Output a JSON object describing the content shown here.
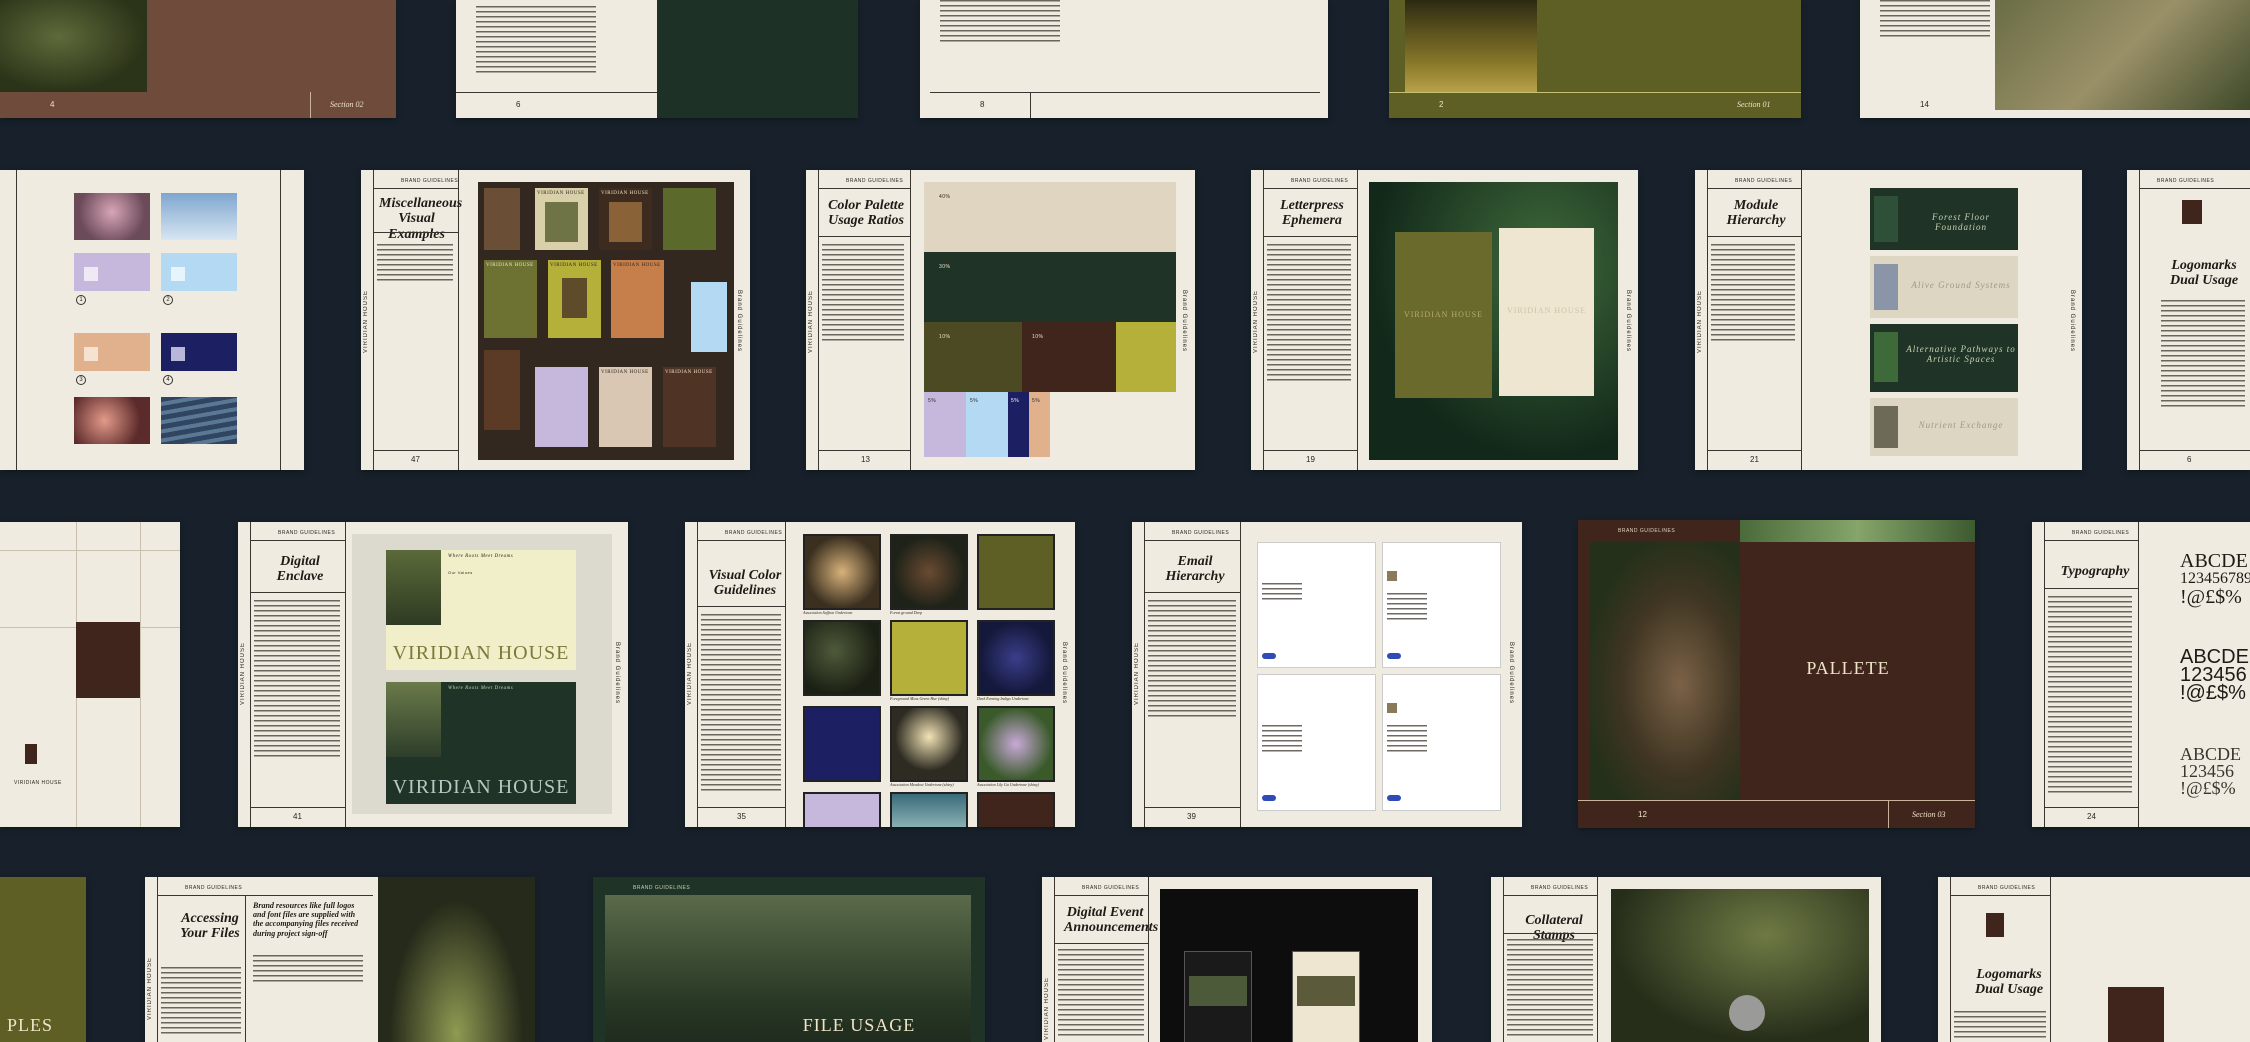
{
  "page": {
    "brand_label": "BRAND GUIDELINES",
    "brand_vertical": "VIRIDIAN HOUSE",
    "brand_vertical_right": "Brand Guidelines"
  },
  "colors": {
    "background": "#18212b",
    "paper": "#efebe1",
    "olive": "#5d5f25",
    "forest": "#1f3327",
    "brown": "#40251d",
    "lime": "#b5b03a",
    "lavender": "#c6b8dd",
    "sky": "#b4d9f2",
    "navy": "#1d1f63",
    "peach": "#e1b08c",
    "beige": "#dfd5c1"
  },
  "row1": {
    "s1": {
      "page": "4",
      "section": "Section 02"
    },
    "s2": {
      "page": "6"
    },
    "s3": {
      "page": "8"
    },
    "s4": {
      "page": "2",
      "section": "Section 01"
    },
    "s5": {
      "page": "14"
    }
  },
  "row2": {
    "misc": {
      "title": "Miscellaneous Visual Examples",
      "page": "47",
      "poster_label": "VIRIDIAN HOUSE"
    },
    "palette": {
      "title": "Color Palette Usage Ratios",
      "page": "13",
      "ratios": [
        "40%",
        "30%",
        "10%",
        "10%",
        "5%",
        "5%",
        "5%",
        "5%"
      ]
    },
    "letterpress": {
      "title": "Letterpress Ephemera",
      "page": "19",
      "card_label": "VIRIDIAN HOUSE"
    },
    "module": {
      "title": "Module Hierarchy",
      "page": "21",
      "modules": [
        "Forest Floor Foundation",
        "Alive Ground Systems",
        "Alternative Pathways to Artistic Spaces",
        "Nutrient Exchange"
      ]
    },
    "logomarks": {
      "title": "Logomarks Dual Usage",
      "page": "6"
    },
    "colors_left": {
      "labels": [
        "1",
        "2",
        "3",
        "4"
      ]
    }
  },
  "row3": {
    "left_mark": {
      "label": "VIRIDIAN HOUSE"
    },
    "digital": {
      "title": "Digital Enclave",
      "page": "41",
      "banner": "VIRIDIAN HOUSE",
      "site_title": "Where Roots Meet Dreams",
      "site_heading": "Our Values"
    },
    "visual": {
      "title": "Visual Color Guidelines",
      "page": "35",
      "captions": [
        "Association Saffron Undertone",
        "Forest ground Deep",
        "",
        "Foreground Moss Green Hue (shiny)",
        "Dark Evening Indigo Undertone",
        "",
        "Association Meadow Undertone (shiny)",
        "Association Lily Ga Undertone (shiny)"
      ]
    },
    "email": {
      "title": "Email Hierarchy",
      "page": "39"
    },
    "pallete": {
      "title": "PALLETE",
      "page": "12",
      "section": "Section 03"
    },
    "typography": {
      "title": "Typography",
      "page": "24",
      "glyphs1": "ABCDE",
      "glyphs1b": "123456789",
      "glyphs1c": "!@£$%",
      "glyphs2": "ABCDE",
      "glyphs2b": "123456",
      "glyphs2c": "!@£$%",
      "glyphs3": "ABCDE",
      "glyphs3b": "123456",
      "glyphs3c": "!@£$%"
    }
  },
  "row4": {
    "ples": {
      "text": "PLES"
    },
    "access": {
      "title": "Accessing Your Files",
      "quote": "Brand resources like full logos and font files are supplied with the accompanying files received during project sign-off"
    },
    "fileusage": {
      "title": "FILE USAGE"
    },
    "digitalevent": {
      "title": "Digital Event Announcements"
    },
    "collateral": {
      "title": "Collateral Stamps"
    },
    "logomarks2": {
      "title": "Logomarks Dual Usage"
    }
  }
}
